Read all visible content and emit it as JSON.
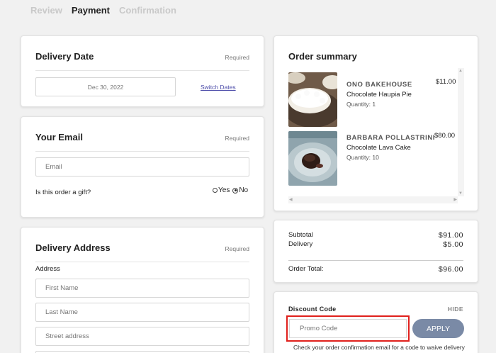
{
  "steps": [
    "Review",
    "Payment",
    "Confirmation"
  ],
  "delivery_date": {
    "title": "Delivery Date",
    "required_label": "Required",
    "date_value": "Dec 30, 2022",
    "switch_link": "Switch Dates"
  },
  "email": {
    "title": "Your Email",
    "required_label": "Required",
    "email_placeholder": "Email",
    "gift_question": "Is this order a gift?",
    "gift_options": [
      "Yes",
      "No"
    ],
    "gift_selected": "No"
  },
  "address": {
    "title": "Delivery Address",
    "required_label": "Required",
    "section_label": "Address",
    "first_name_placeholder": "First Name",
    "last_name_placeholder": "Last Name",
    "street_placeholder": "Street address"
  },
  "order_summary": {
    "title": "Order summary",
    "items": [
      {
        "vendor": "ONO BAKEHOUSE",
        "name": "Chocolate Haupia Pie",
        "quantity": "Quantity: 1",
        "price": "$11.00"
      },
      {
        "vendor": "BARBARA POLLASTRINI",
        "name": "Chocolate Lava Cake",
        "quantity": "Quantity: 10",
        "price": "$80.00"
      }
    ]
  },
  "totals": {
    "subtotal_label": "Subtotal",
    "subtotal_value": "$91.00",
    "delivery_label": "Delivery",
    "delivery_value": "$5.00",
    "total_label": "Order Total:",
    "total_value": "$96.00"
  },
  "discount": {
    "title": "Discount Code",
    "hide_label": "HIDE",
    "promo_placeholder": "Promo Code",
    "apply_label": "APPLY",
    "note": "Check your order confirmation email for a code to waive delivery"
  },
  "colors": {
    "apply_button": "#7a8aa6",
    "promo_highlight": "#e0201c",
    "link": "#4a4aa8"
  }
}
